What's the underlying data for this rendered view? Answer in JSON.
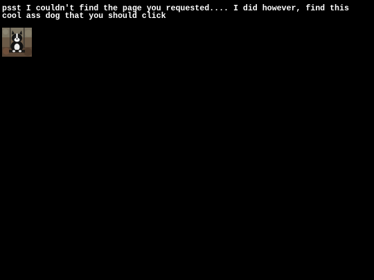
{
  "page": {
    "background": "#000000",
    "text_color": "#ffffff",
    "message": "psst I couldn't find the page you requested.... I did however, find this cool ass dog that you should click"
  },
  "dog_link": {
    "icon": "dog-photo-icon"
  }
}
